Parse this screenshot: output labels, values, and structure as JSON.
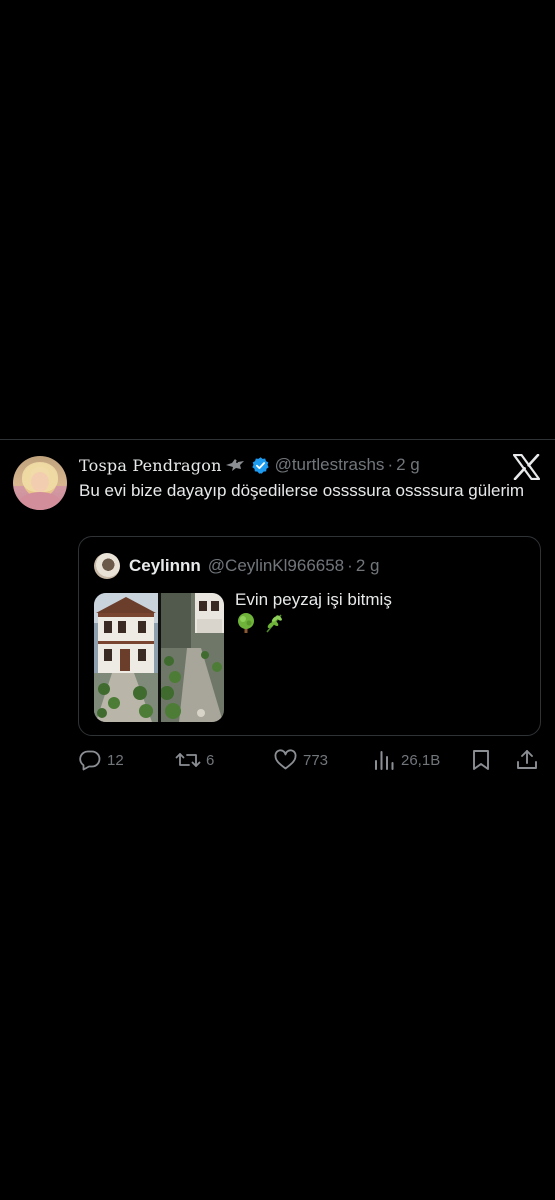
{
  "tweet": {
    "display_name": "Tospa Pendragon",
    "handle": "@turtlestrashs",
    "separator": "·",
    "time": "2 g",
    "text": "Bu evi bize dayayıp döşedilerse ossssura ossssura gülerim",
    "icons": {
      "name_badge": "bird-icon",
      "verified": "verified-badge-icon",
      "brand": "x-logo-icon"
    },
    "colors": {
      "verified": "#1d9bf0",
      "muted_text": "#71767b",
      "primary_text": "#e7e9ea",
      "border": "#2f3336",
      "background": "#000000"
    }
  },
  "quote": {
    "display_name": "Ceylinnn",
    "handle": "@CeylinKl966658",
    "separator": "·",
    "time": "2 g",
    "text": "Evin peyzaj işi bitmiş",
    "emojis": [
      "tree-emoji",
      "herb-emoji"
    ],
    "media": [
      "house-photo",
      "garden-path-photo"
    ]
  },
  "actions": {
    "replies": {
      "icon": "reply-icon",
      "count": "12"
    },
    "retweets": {
      "icon": "retweet-icon",
      "count": "6"
    },
    "likes": {
      "icon": "heart-icon",
      "count": "773"
    },
    "views": {
      "icon": "views-icon",
      "count": "26,1B"
    },
    "bookmark": {
      "icon": "bookmark-icon"
    },
    "share": {
      "icon": "share-icon"
    }
  }
}
